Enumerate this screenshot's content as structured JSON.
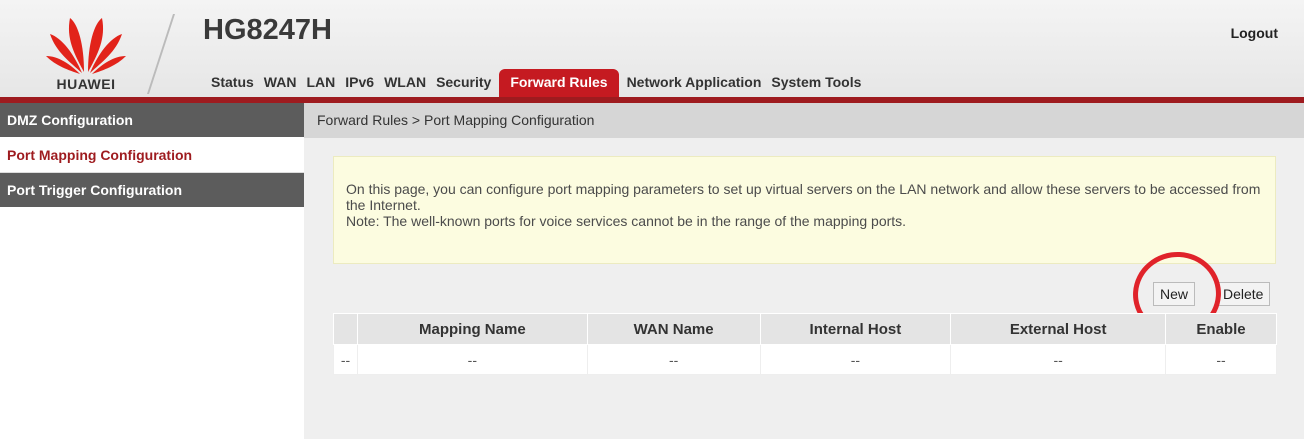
{
  "brand": {
    "logo_text": "HUAWEI",
    "model": "HG8247H",
    "logo_color": "#e2231a"
  },
  "header": {
    "logout": "Logout"
  },
  "nav": {
    "items": [
      "Status",
      "WAN",
      "LAN",
      "IPv6",
      "WLAN",
      "Security",
      "Forward Rules",
      "Network Application",
      "System Tools"
    ],
    "active": "Forward Rules",
    "active_color": "#c51a21"
  },
  "sidebar": {
    "items": [
      {
        "label": "DMZ Configuration",
        "state": "dark"
      },
      {
        "label": "Port Mapping Configuration",
        "state": "current"
      },
      {
        "label": "Port Trigger Configuration",
        "state": "dark"
      }
    ]
  },
  "main": {
    "breadcrumb": "Forward Rules > Port Mapping Configuration",
    "notice_line1": "On this page, you can configure port mapping parameters to set up virtual servers on the LAN network and allow these servers to be accessed from the Internet.",
    "notice_line2": "Note: The well-known ports for voice services cannot be in the range of the mapping ports.",
    "buttons": {
      "new": "New",
      "delete": "Delete"
    },
    "table": {
      "headers": [
        "",
        "Mapping Name",
        "WAN Name",
        "Internal Host",
        "External Host",
        "Enable"
      ],
      "rows": [
        [
          "--",
          "--",
          "--",
          "--",
          "--",
          "--"
        ]
      ]
    }
  },
  "annotation": {
    "circle_color": "#e0232a"
  }
}
